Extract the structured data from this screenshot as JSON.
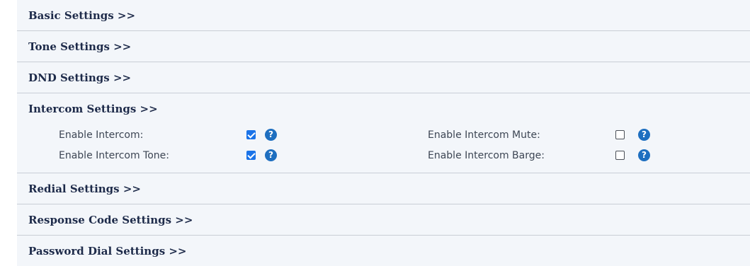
{
  "sections": {
    "basic": "Basic Settings >>",
    "tone": "Tone Settings >>",
    "dnd": "DND Settings >>",
    "intercom": "Intercom Settings >>",
    "redial": "Redial Settings >>",
    "response_code": "Response Code Settings >>",
    "password_dial": "Password Dial Settings >>"
  },
  "intercom": {
    "enable_intercom": {
      "label": "Enable Intercom:",
      "checked": true
    },
    "enable_intercom_tone": {
      "label": "Enable Intercom Tone:",
      "checked": true
    },
    "enable_intercom_mute": {
      "label": "Enable Intercom Mute:",
      "checked": false
    },
    "enable_intercom_barge": {
      "label": "Enable Intercom Barge:",
      "checked": false
    },
    "help_glyph": "?"
  },
  "colors": {
    "accent": "#1a73e8",
    "help_icon": "#1e6fc0",
    "header_text": "#1e2b4a",
    "panel_bg": "#f3f6fa"
  },
  "icons": {
    "help": "question-circle-icon",
    "checkbox": "checkbox-icon"
  }
}
